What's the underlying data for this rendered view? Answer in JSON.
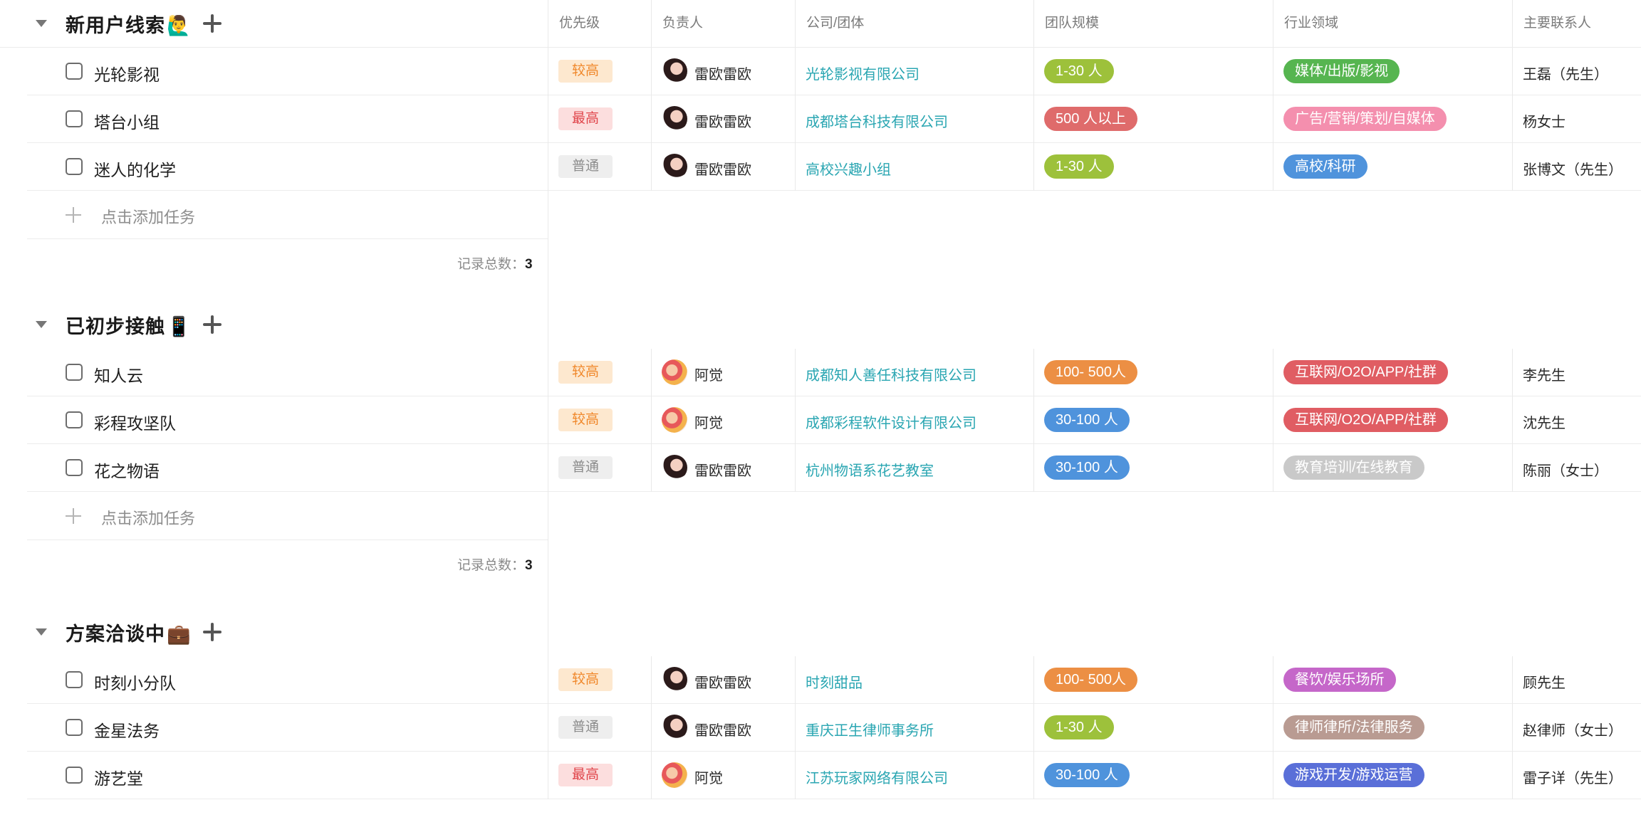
{
  "columns": [
    {
      "name": "col-priority",
      "label": "优先级"
    },
    {
      "name": "col-owner",
      "label": "负责人"
    },
    {
      "name": "col-company",
      "label": "公司/团体"
    },
    {
      "name": "col-team-size",
      "label": "团队规模"
    },
    {
      "name": "col-industry",
      "label": "行业领域"
    },
    {
      "name": "col-contact",
      "label": "主要联系人"
    }
  ],
  "add_task_label": "点击添加任务",
  "record_count_label": "记录总数：",
  "tag_colors": {
    "size": {
      "1-30 人": "#9dc13b",
      "500 人以上": "#df6b6b",
      "100- 500人": "#ec8f44",
      "30-100 人": "#4f93dc"
    },
    "industry": {
      "媒体/出版/影视": "#56b550",
      "广告/营销/策划/自媒体": "#f48fae",
      "高校/科研": "#4f93dc",
      "互联网/O2O/APP/社群": "#e05d63",
      "教育培训/在线教育": "#c9c9c9",
      "餐饮/娱乐场所": "#c567c9",
      "律师律所/法律服务": "#b99b92",
      "游戏开发/游戏运营": "#5a6fd8"
    }
  },
  "groups": [
    {
      "title": "新用户线索",
      "emoji": "🙋‍♂️",
      "record_count": "3",
      "tasks": [
        {
          "name": "光轮影视",
          "priority": "较高",
          "priority_level": "high",
          "owner": "雷欧雷欧",
          "owner_avatar": "a1",
          "company": "光轮影视有限公司",
          "team_size": "1-30 人",
          "industry": "媒体/出版/影视",
          "contact": "王磊（先生）"
        },
        {
          "name": "塔台小组",
          "priority": "最高",
          "priority_level": "top",
          "owner": "雷欧雷欧",
          "owner_avatar": "a1",
          "company": "成都塔台科技有限公司",
          "team_size": "500 人以上",
          "industry": "广告/营销/策划/自媒体",
          "contact": "杨女士"
        },
        {
          "name": "迷人的化学",
          "priority": "普通",
          "priority_level": "normal",
          "owner": "雷欧雷欧",
          "owner_avatar": "a1",
          "company": "高校兴趣小组",
          "team_size": "1-30 人",
          "industry": "高校/科研",
          "contact": "张博文（先生）"
        }
      ]
    },
    {
      "title": "已初步接触",
      "emoji": "📱",
      "record_count": "3",
      "tasks": [
        {
          "name": "知人云",
          "priority": "较高",
          "priority_level": "high",
          "owner": "阿觉",
          "owner_avatar": "a2",
          "company": "成都知人善任科技有限公司",
          "team_size": "100- 500人",
          "industry": "互联网/O2O/APP/社群",
          "contact": "李先生"
        },
        {
          "name": "彩程攻坚队",
          "priority": "较高",
          "priority_level": "high",
          "owner": "阿觉",
          "owner_avatar": "a2",
          "company": "成都彩程软件设计有限公司",
          "team_size": "30-100 人",
          "industry": "互联网/O2O/APP/社群",
          "contact": "沈先生"
        },
        {
          "name": "花之物语",
          "priority": "普通",
          "priority_level": "normal",
          "owner": "雷欧雷欧",
          "owner_avatar": "a1",
          "company": "杭州物语系花艺教室",
          "team_size": "30-100 人",
          "industry": "教育培训/在线教育",
          "contact": "陈丽（女士）"
        }
      ]
    },
    {
      "title": "方案洽谈中",
      "emoji": "💼",
      "tasks": [
        {
          "name": "时刻小分队",
          "priority": "较高",
          "priority_level": "high",
          "owner": "雷欧雷欧",
          "owner_avatar": "a1",
          "company": "时刻甜品",
          "team_size": "100- 500人",
          "industry": "餐饮/娱乐场所",
          "contact": "顾先生"
        },
        {
          "name": "金星法务",
          "priority": "普通",
          "priority_level": "normal",
          "owner": "雷欧雷欧",
          "owner_avatar": "a1",
          "company": "重庆正生律师事务所",
          "team_size": "1-30 人",
          "industry": "律师律所/法律服务",
          "contact": "赵律师（女士）"
        },
        {
          "name": "游艺堂",
          "priority": "最高",
          "priority_level": "top",
          "owner": "阿觉",
          "owner_avatar": "a2",
          "company": "江苏玩家网络有限公司",
          "team_size": "30-100 人",
          "industry": "游戏开发/游戏运营",
          "contact": "雷子详（先生）"
        }
      ]
    }
  ]
}
